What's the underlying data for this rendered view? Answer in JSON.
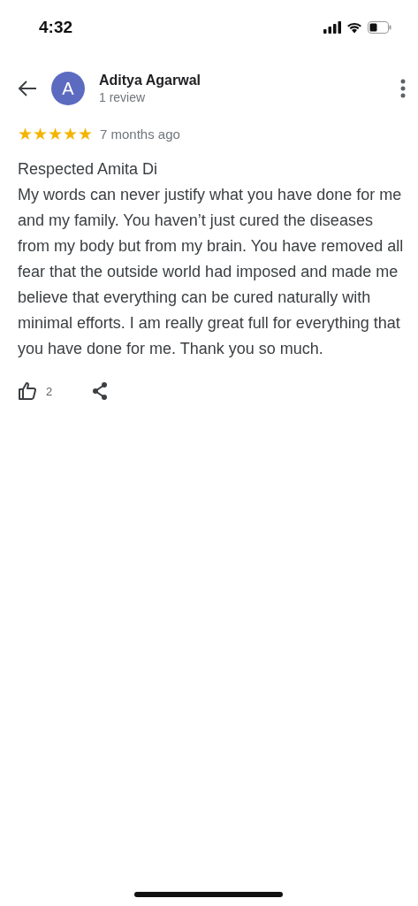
{
  "status_bar": {
    "time": "4:32"
  },
  "reviewer": {
    "initial": "A",
    "name": "Aditya Agarwal",
    "review_count": "1 review"
  },
  "review": {
    "stars": 5,
    "age": "7 months ago",
    "greeting": "Respected Amita Di",
    "body": "My words can never justify what you have done for me and my family. You haven’t just cured the diseases from my body but from my brain. You have removed all fear that the outside world had imposed and made me believe that everything can be cured naturally with minimal efforts. I am really great full for everything that you have done for me. Thank you so much."
  },
  "actions": {
    "likes": "2"
  }
}
